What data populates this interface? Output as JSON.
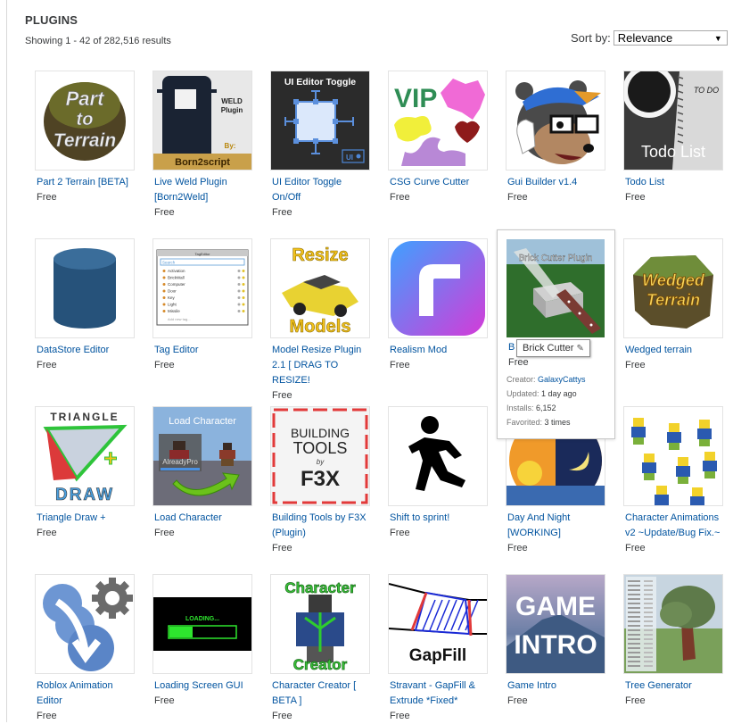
{
  "header": {
    "title": "PLUGINS",
    "results_text": "Showing 1 - 42 of 282,516 results",
    "sort_label": "Sort by:",
    "sort_selected": "Relevance",
    "sort_arrow": "▼"
  },
  "colors": {
    "link": "#00539f",
    "text": "#393b3d"
  },
  "items": [
    {
      "name": "Part 2 Terrain [BETA]",
      "price": "Free",
      "thumb": "part-to-terrain"
    },
    {
      "name": "Live Weld Plugin [Born2Weld]",
      "price": "Free",
      "thumb": "weld-plugin"
    },
    {
      "name": "UI Editor Toggle On/Off",
      "price": "Free",
      "thumb": "ui-editor-toggle"
    },
    {
      "name": "CSG Curve Cutter",
      "price": "Free",
      "thumb": "csg-shapes"
    },
    {
      "name": "Gui Builder v1.4",
      "price": "Free",
      "thumb": "bear-mascot"
    },
    {
      "name": "Todo List",
      "price": "Free",
      "thumb": "todo-list"
    },
    {
      "name": "DataStore Editor",
      "price": "Free",
      "thumb": "datastore-cylinder"
    },
    {
      "name": "Tag Editor",
      "price": "Free",
      "thumb": "tag-editor-window"
    },
    {
      "name": "Model Resize Plugin 2.1 [ DRAG TO RESIZE!",
      "price": "Free",
      "thumb": "resize-models-taxi"
    },
    {
      "name": "Realism Mod",
      "price": "Free",
      "thumb": "realism-r-logo"
    },
    {
      "name": "Brick Cutter",
      "price": "Free",
      "thumb": "brick-cutter-knife"
    },
    {
      "name": "Wedged terrain",
      "price": "Free",
      "thumb": "wedged-terrain"
    },
    {
      "name": "Triangle Draw +",
      "price": "Free",
      "thumb": "triangle-draw"
    },
    {
      "name": "Load Character",
      "price": "Free",
      "thumb": "load-character"
    },
    {
      "name": "Building Tools by F3X (Plugin)",
      "price": "Free",
      "thumb": "building-tools-f3x"
    },
    {
      "name": "Shift to sprint!",
      "price": "Free",
      "thumb": "running-man"
    },
    {
      "name": "Day And Night [WORKING]",
      "price": "Free",
      "thumb": "day-night"
    },
    {
      "name": "Character Animations v2 ~Update/Bug Fix.~",
      "price": "Free",
      "thumb": "character-animations"
    },
    {
      "name": "Roblox Animation Editor",
      "price": "Free",
      "thumb": "animation-editor"
    },
    {
      "name": "Loading Screen GUI",
      "price": "Free",
      "thumb": "loading-screen"
    },
    {
      "name": "Character Creator [ BETA ]",
      "price": "Free",
      "thumb": "character-creator"
    },
    {
      "name": "Stravant - GapFill & Extrude *Fixed*",
      "price": "Free",
      "thumb": "gapfill"
    },
    {
      "name": "Game Intro",
      "price": "Free",
      "thumb": "game-intro"
    },
    {
      "name": "Tree Generator",
      "price": "Free",
      "thumb": "tree-generator"
    }
  ],
  "thumb_text": {
    "part_to_terrain": [
      "Part",
      "to",
      "Terrain"
    ],
    "weld": [
      "WELD",
      "Plugin",
      "By:",
      "Born2script"
    ],
    "ui_editor": "UI Editor Toggle",
    "ui_badge": "UI",
    "vip": "VIP",
    "todo_heading": "TO DO",
    "todo_title": "Todo List",
    "resize": [
      "Resize",
      "Models"
    ],
    "brick_cutter": "Brick Cutter Plugin",
    "wedged": [
      "Wedged",
      "Terrain"
    ],
    "triangle": [
      "TRIANGLE",
      "DRAW",
      "+"
    ],
    "load_character": "Load Character",
    "load_character_user": "AlreadyPro",
    "f3x": [
      "BUILDING",
      "TOOLS",
      "by",
      "F3X"
    ],
    "loading": "LOADING...",
    "character_creator": [
      "Character",
      "Creator"
    ],
    "gapfill": "GapFill",
    "game_intro": [
      "GAME",
      "INTRO"
    ],
    "tag_editor_title": "TagEditor",
    "tag_editor_search": "Search",
    "tag_editor_tags": [
      "Activation",
      "BrickWall",
      "Computer",
      "Door",
      "Key",
      "Light",
      "Missile"
    ],
    "tag_editor_add": "Add new tag..."
  },
  "hover_card": {
    "name_initial": "B",
    "tooltip": "Brick Cutter",
    "tooltip_icon": "✎",
    "price": "Free",
    "creator_label": "Creator:",
    "creator": "GalaxyCattys",
    "updated_label": "Updated:",
    "updated": "1 day ago",
    "installs_label": "Installs:",
    "installs": "6,152",
    "favorited_label": "Favorited:",
    "favorited": "3 times"
  }
}
